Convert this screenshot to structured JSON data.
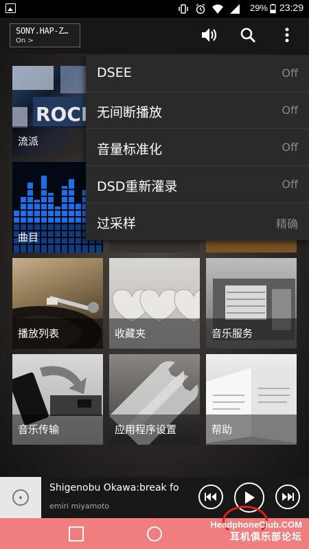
{
  "status_bar": {
    "battery_percent": "29%",
    "time": "23:29",
    "icons": [
      "gallery-icon",
      "vibrate-icon",
      "alarm-icon",
      "wifi-icon",
      "signal-icon",
      "battery-icon"
    ]
  },
  "toolbar": {
    "device_name": "SONY.HAP-Z…",
    "device_status": "On >",
    "icons": [
      "volume-icon",
      "search-icon",
      "overflow-menu-icon"
    ]
  },
  "tiles": [
    {
      "label": "流派",
      "image": "genre-collage"
    },
    {
      "label": "",
      "image": "partial-tile"
    },
    {
      "label": "",
      "image": "partial-tile"
    },
    {
      "label": "曲目",
      "image": "blue-equalizer"
    },
    {
      "label": "",
      "image": "partial-tile"
    },
    {
      "label": "",
      "image": "partial-tile"
    },
    {
      "label": "播放列表",
      "image": "turntable"
    },
    {
      "label": "收藏夹",
      "image": "hearts"
    },
    {
      "label": "音乐服务",
      "image": "radio"
    },
    {
      "label": "音乐传输",
      "image": "phone-transfer"
    },
    {
      "label": "应用程序设置",
      "image": "wrenches"
    },
    {
      "label": "帮助",
      "image": "manual-book"
    }
  ],
  "menu": {
    "items": [
      {
        "label": "DSEE",
        "value": "Off"
      },
      {
        "label": "无间断播放",
        "value": "Off"
      },
      {
        "label": "音量标准化",
        "value": "Off"
      },
      {
        "label": "DSD重新灌录",
        "value": "Off"
      },
      {
        "label": "过采样",
        "value": "精确"
      }
    ]
  },
  "now_playing": {
    "title": "Shigenobu Okawa:break fo",
    "artist": "emiri miyamoto",
    "icons": [
      "previous-icon",
      "play-icon",
      "next-icon"
    ]
  },
  "nav_bar": {
    "icons": [
      "recents-icon",
      "home-icon"
    ],
    "watermark_line1": "HeadphoneClub.COM",
    "watermark_line2": "耳机俱乐部论坛"
  },
  "colors": {
    "menu_bg": "#2a2a2a",
    "menu_value": "#888888",
    "nav_bar": "#f07e7e"
  }
}
